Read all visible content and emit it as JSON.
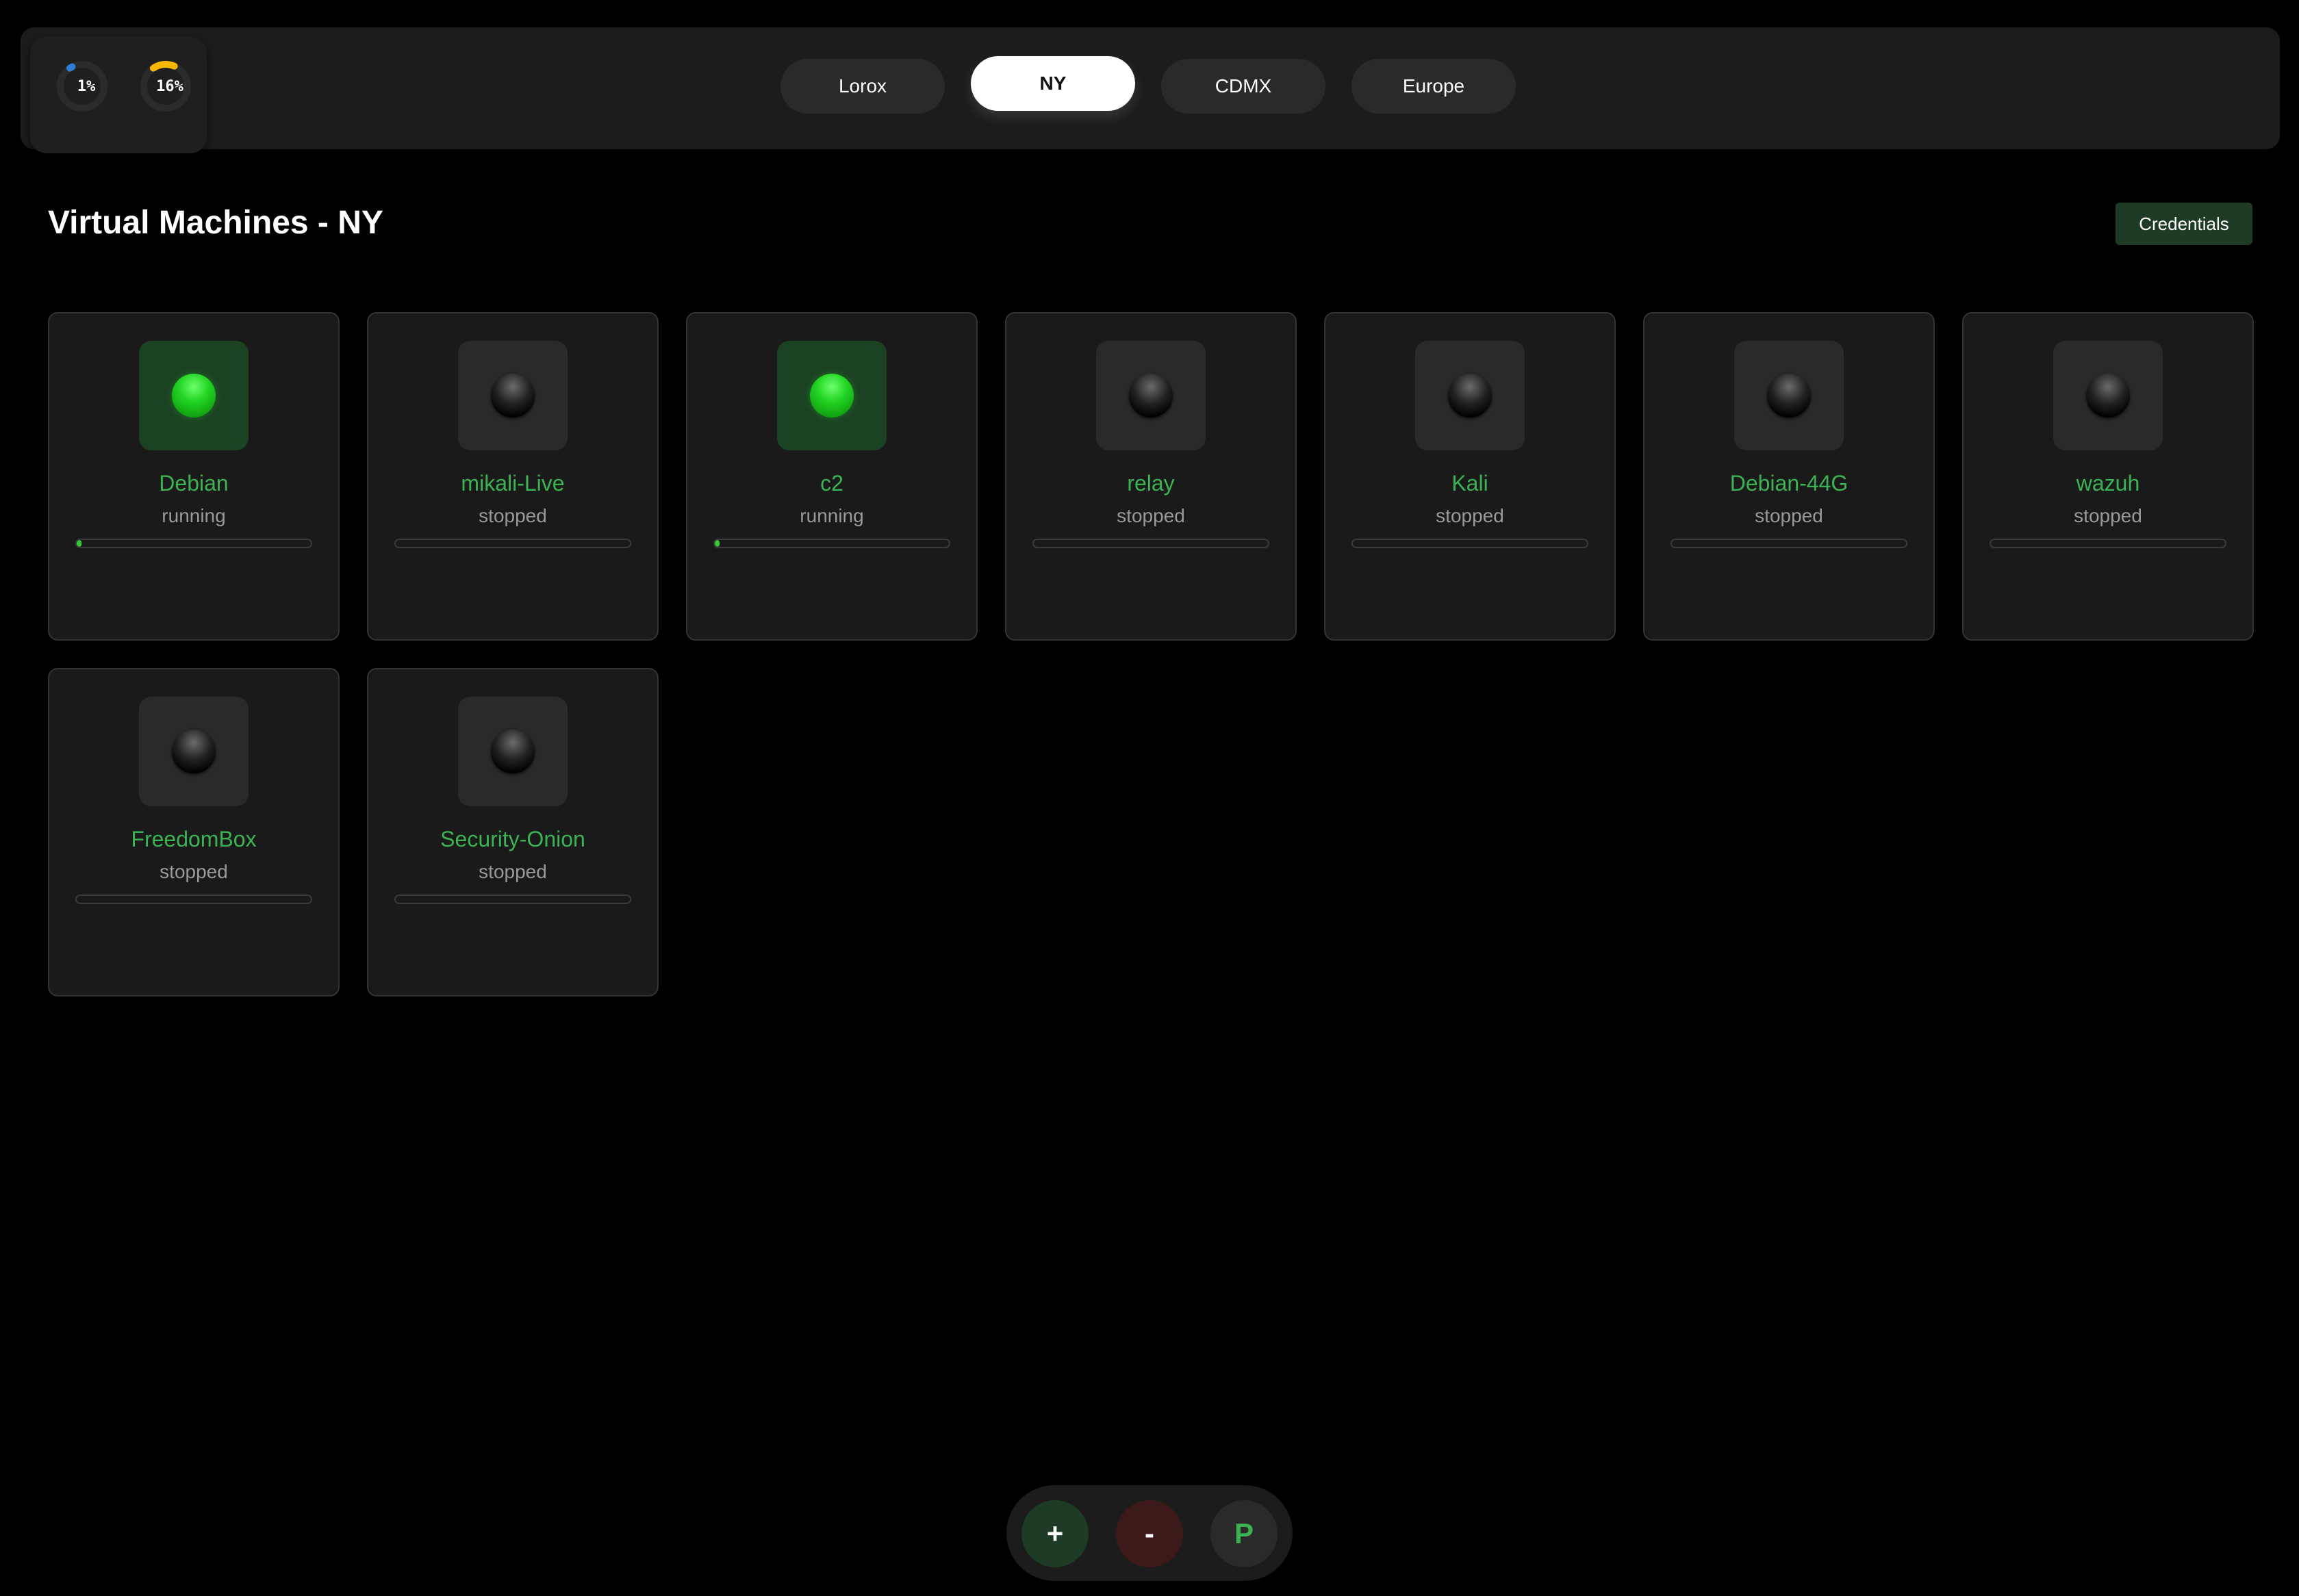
{
  "gauges": [
    {
      "id": "gauge-1",
      "text": "1%",
      "value": 1,
      "color": "#2a7fd4"
    },
    {
      "id": "gauge-2",
      "text": "16%",
      "value": 16,
      "color": "#f5b700"
    }
  ],
  "tabs": [
    {
      "label": "Lorox",
      "active": false
    },
    {
      "label": "NY",
      "active": true
    },
    {
      "label": "CDMX",
      "active": false
    },
    {
      "label": "Europe",
      "active": false
    }
  ],
  "header": {
    "title": "Virtual Machines - NY",
    "credentials_label": "Credentials"
  },
  "vms": [
    {
      "name": "Debian",
      "status": "running",
      "progress": 0.02
    },
    {
      "name": "mikali-Live",
      "status": "stopped",
      "progress": 0
    },
    {
      "name": "c2",
      "status": "running",
      "progress": 0.02
    },
    {
      "name": "relay",
      "status": "stopped",
      "progress": 0
    },
    {
      "name": "Kali",
      "status": "stopped",
      "progress": 0
    },
    {
      "name": "Debian-44G",
      "status": "stopped",
      "progress": 0
    },
    {
      "name": "wazuh",
      "status": "stopped",
      "progress": 0
    },
    {
      "name": "FreedomBox",
      "status": "stopped",
      "progress": 0
    },
    {
      "name": "Security-Onion",
      "status": "stopped",
      "progress": 0
    }
  ],
  "actions": {
    "add_label": "+",
    "remove_label": "-",
    "power_label": "P"
  },
  "colors": {
    "accent_green": "#3cb353",
    "running_led": "#22d422",
    "running_tile": "#1c4224",
    "credentials_bg": "#1d3b25",
    "remove_bg": "#3d1a1a"
  }
}
